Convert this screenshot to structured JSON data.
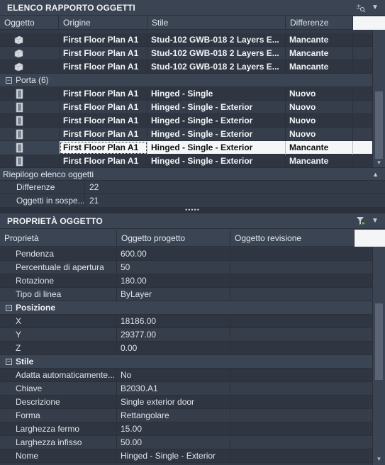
{
  "panel1": {
    "title": "ELENCO RAPPORTO OGGETTI",
    "columns": [
      "Oggetto",
      "Origine",
      "Stile",
      "Differenze"
    ],
    "top_rows": [
      {
        "origin": "First Floor Plan A1",
        "style": "Stud-102 GWB-018 2 Layers E...",
        "diff": "Mancante"
      },
      {
        "origin": "First Floor Plan A1",
        "style": "Stud-102 GWB-018 2 Layers E...",
        "diff": "Mancante"
      },
      {
        "origin": "First Floor Plan A1",
        "style": "Stud-102 GWB-018 2 Layers E...",
        "diff": "Mancante"
      }
    ],
    "group_label": "Porta (6)",
    "door_rows": [
      {
        "origin": "First Floor Plan A1",
        "style": "Hinged - Single",
        "diff": "Nuovo"
      },
      {
        "origin": "First Floor Plan A1",
        "style": "Hinged - Single - Exterior",
        "diff": "Nuovo"
      },
      {
        "origin": "First Floor Plan A1",
        "style": "Hinged - Single - Exterior",
        "diff": "Nuovo"
      },
      {
        "origin": "First Floor Plan A1",
        "style": "Hinged - Single - Exterior",
        "diff": "Nuovo"
      },
      {
        "origin": "First Floor Plan A1",
        "style": "Hinged - Single - Exterior",
        "diff": "Mancante"
      },
      {
        "origin": "First Floor Plan A1",
        "style": "Hinged - Single - Exterior",
        "diff": "Mancante"
      }
    ]
  },
  "summary": {
    "title": "Riepilogo elenco oggetti",
    "rows": [
      {
        "label": "Differenze",
        "value": "22"
      },
      {
        "label": "Oggetti in sospe...",
        "value": "21"
      }
    ]
  },
  "splitter_glyph": "•••••",
  "panel2": {
    "title": "PROPRIETÀ OGGETTO",
    "columns": [
      "Proprietà",
      "Oggetto progetto",
      "Oggetto revisione"
    ],
    "rows_a": [
      {
        "label": "Pendenza",
        "value": "600.00"
      },
      {
        "label": "Percentuale di apertura",
        "value": "50"
      },
      {
        "label": "Rotazione",
        "value": "180.00"
      },
      {
        "label": "Tipo di linea",
        "value": "ByLayer"
      }
    ],
    "group_position": "Posizione",
    "rows_b": [
      {
        "label": "X",
        "value": "18186.00"
      },
      {
        "label": "Y",
        "value": "29377.00"
      },
      {
        "label": "Z",
        "value": "0.00"
      }
    ],
    "group_style": "Stile",
    "rows_c": [
      {
        "label": "Adatta automaticamente...",
        "value": "No"
      },
      {
        "label": "Chiave",
        "value": "B2030.A1"
      },
      {
        "label": "Descrizione",
        "value": "Single exterior door"
      },
      {
        "label": "Forma",
        "value": "Rettangolare"
      },
      {
        "label": "Larghezza fermo",
        "value": "15.00"
      },
      {
        "label": "Larghezza infisso",
        "value": "50.00"
      },
      {
        "label": "Nome",
        "value": "Hinged - Single - Exterior"
      }
    ]
  }
}
